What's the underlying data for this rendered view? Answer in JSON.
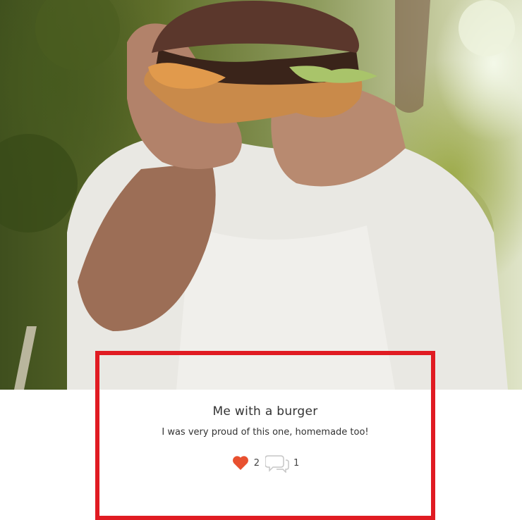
{
  "post": {
    "image_alt": "Man holding a burger close to the camera",
    "title": "Me with a burger",
    "description": "I was very proud of this one, homemade too!",
    "likes": "2",
    "comments": "1"
  },
  "icons": {
    "like": "heart-icon",
    "comment": "comment-bubbles-icon"
  },
  "colors": {
    "like": "#e8502f",
    "highlight": "#e01b22"
  }
}
